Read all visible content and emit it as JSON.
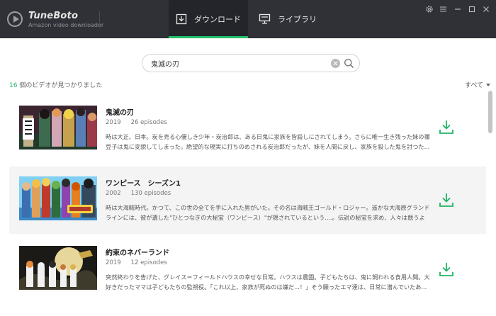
{
  "app": {
    "name": "TuneBoto",
    "subtitle": "Amazon video downloader"
  },
  "tabs": [
    {
      "label": "ダウンロード",
      "active": true,
      "icon": "download-tab-icon"
    },
    {
      "label": "ライブラリ",
      "active": false,
      "icon": "monitor-icon"
    }
  ],
  "window_controls": [
    "gear-icon",
    "menu-icon",
    "minimize-icon",
    "maximize-icon",
    "close-icon"
  ],
  "search": {
    "value": "鬼滅の刃",
    "placeholder": ""
  },
  "results": {
    "count": "16",
    "suffix": " 個のビデオが見つかりました",
    "sort_label": "すべて"
  },
  "colors": {
    "accent": "#21c16d",
    "titlebar": "#2f3137",
    "active_tab": "#23252a"
  },
  "items": [
    {
      "title": "鬼滅の刃",
      "year": "2019",
      "episodes": "26 episodes",
      "description": "時は大正、日本。炭を売る心優しき少年・炭治郎は、ある日鬼に家族を皆殺しにされてしまう。さらに唯一生き残った妹の禰豆子は鬼に変貌してしまった。絶望的な現実に打ちのめされる炭治郎だったが、妹を人間に戻し、家族を殺した鬼を討つた..."
    },
    {
      "title": "ワンピース　シーズン1",
      "year": "2002",
      "episodes": "130 episodes",
      "description": "時は大海賊時代。かつて、この世の全てを手に入れた男がいた。その名は海賊王ゴールド・ロジャー。遥かな大海原グランドラインには、彼が遺した\"ひとつなぎの大秘宝（ワンピース）\"が隠されているという....。伝説の秘宝を求め、人々は競うよう..."
    },
    {
      "title": "約束のネバーランド",
      "year": "2019",
      "episodes": "12 episodes",
      "description": "突然終わりを告げた、グレイス＝フィールドハウスの幸せな日常。ハウスは農園。子どもたちは、鬼に飼われる食用人間。大好きだったママは子どもたちの監視役。「これ以上、家族が死ぬのは嫌だ...！」そう願ったエマ達は、日常に潜んでいたあ..."
    }
  ]
}
